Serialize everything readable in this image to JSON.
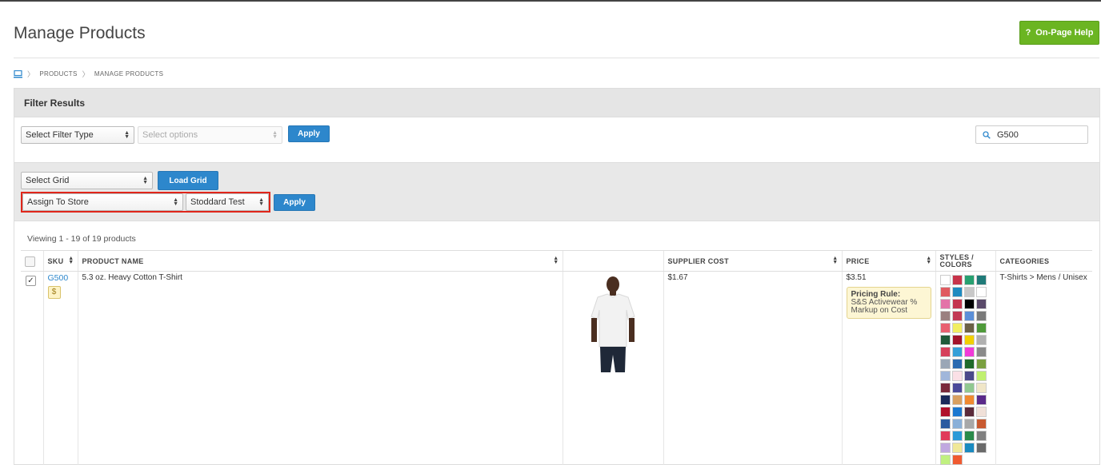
{
  "page": {
    "title": "Manage Products",
    "help_label": "On-Page Help",
    "help_icon": "?"
  },
  "breadcrumb": {
    "items": [
      "PRODUCTS",
      "MANAGE PRODUCTS"
    ]
  },
  "filter": {
    "header": "Filter Results",
    "filter_type": "Select Filter Type",
    "options_placeholder": "Select options",
    "apply_label": "Apply",
    "search_value": "G500"
  },
  "grid": {
    "select_grid": "Select Grid",
    "load_label": "Load Grid",
    "action": "Assign To Store",
    "store": "Stoddard Test",
    "apply_label": "Apply"
  },
  "results": {
    "viewing": "Viewing 1 - 19 of 19 products"
  },
  "table": {
    "headers": {
      "sku": "SKU",
      "name": "PRODUCT NAME",
      "cost": "SUPPLIER COST",
      "price": "PRICE",
      "styles_line1": "STYLES /",
      "styles_line2": "COLORS",
      "categories": "CATEGORIES"
    },
    "row": {
      "sku": "G500",
      "badge": "$",
      "name": "5.3 oz. Heavy Cotton T-Shirt",
      "cost": "$1.67",
      "price": "$3.51",
      "pricing_rule_title": "Pricing Rule:",
      "pricing_rule_text": "S&S Activewear % Markup on Cost",
      "categories": "T-Shirts > Mens / Unisex",
      "checked": true,
      "swatches": [
        "#ffffff",
        "#c8344a",
        "#27a070",
        "#1f7a78",
        "#e05a60",
        "#1e8bc0",
        "#c8c8c8",
        "#ffffff",
        "#e373a8",
        "#c4364f",
        "#000000",
        "#5a4a6a",
        "#9a8080",
        "#c23a55",
        "#5b8fd8",
        "#7a7a7a",
        "#e86070",
        "#f1ee60",
        "#6b6145",
        "#4f9a3a",
        "#1f5a3a",
        "#a3142a",
        "#f2d000",
        "#b0b0b0",
        "#d6405a",
        "#34a0d8",
        "#f03ad8",
        "#8a8a8a",
        "#9aa6b6",
        "#2a6ab0",
        "#1f6a2a",
        "#7aa040",
        "#a0b6da",
        "#fbe0e6",
        "#4a4a8a",
        "#c0f070",
        "#7a2a3a",
        "#4a4a9a",
        "#90c890",
        "#f0e6c8",
        "#1a2a5a",
        "#d8a060",
        "#f08a30",
        "#5a2a8a",
        "#b0102a",
        "#1a78d0",
        "#5a2a3a",
        "#f0e0d8",
        "#2a5aa0",
        "#8ab0d8",
        "#a8a8a8",
        "#c85a30",
        "#e03a5a",
        "#2a9ad8",
        "#2a8a4a",
        "#808080",
        "#c0a8e0",
        "#f0e898",
        "#1a8ac0",
        "#6a6a6a",
        "#c0f080",
        "#f05a30"
      ]
    }
  },
  "colors": {
    "accent": "#2d87cc",
    "help": "#6bb522",
    "highlight": "#e0261b"
  }
}
